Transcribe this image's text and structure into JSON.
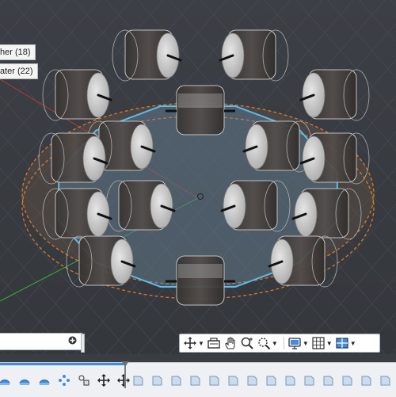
{
  "viewport": {
    "tooltips": [
      {
        "label": "her (18)"
      },
      {
        "label": "ater (22)"
      }
    ]
  },
  "navbar": {
    "items": [
      {
        "name": "orbit",
        "icon": "orbit-icon"
      },
      {
        "name": "look-at",
        "icon": "look-at-icon"
      },
      {
        "name": "pan",
        "icon": "pan-hand-icon"
      },
      {
        "name": "zoom",
        "icon": "zoom-icon"
      },
      {
        "name": "fit",
        "icon": "zoom-window-icon"
      },
      {
        "name": "display-settings",
        "icon": "display-monitor-icon"
      },
      {
        "name": "grid",
        "icon": "grid-icon"
      },
      {
        "name": "viewports",
        "icon": "viewports-icon"
      }
    ]
  },
  "browser_strip": {
    "add_icon": "plus-circle-icon"
  },
  "timeline": {
    "left_items": [
      "sketch-icon",
      "sketch-icon",
      "sketch-icon",
      "pattern-icon",
      "joint-icon",
      "move-icon",
      "move-icon"
    ],
    "right_items": [
      "feature-icon",
      "feature-icon",
      "feature-icon",
      "feature-icon",
      "feature-icon",
      "feature-icon",
      "feature-icon",
      "feature-icon",
      "feature-icon",
      "feature-icon",
      "feature-icon",
      "feature-icon",
      "feature-icon",
      "feature-icon"
    ]
  },
  "colors": {
    "accent_blue": "#3d8ee0",
    "ring_orange": "#d9782a",
    "viewport_bg": "#3a3d42"
  }
}
